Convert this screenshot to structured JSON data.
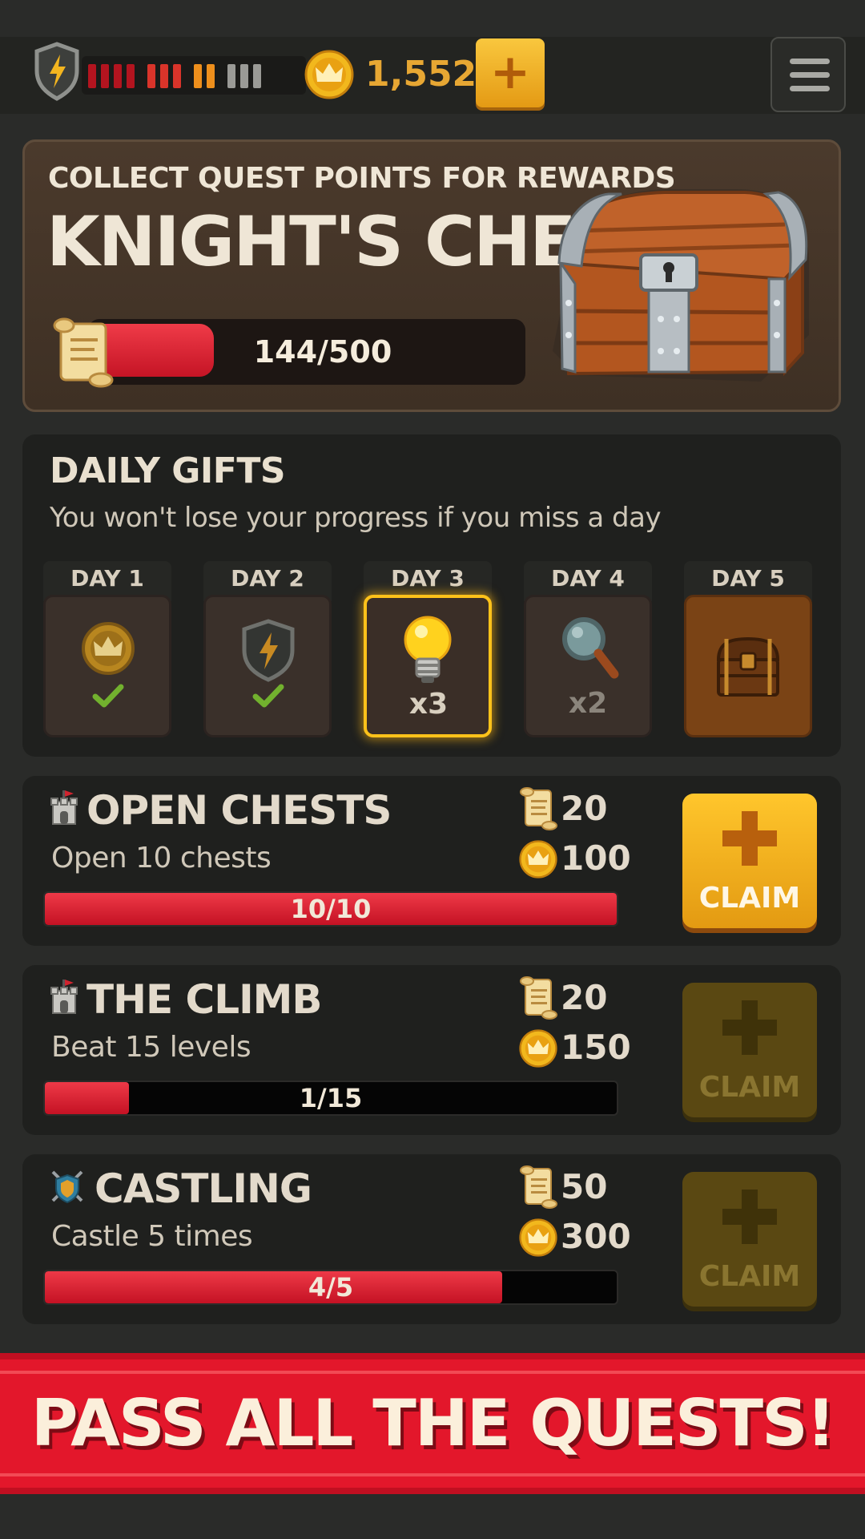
{
  "header": {
    "energy_segments": 13,
    "energy_colors": [
      "#b3141f",
      "#d9342a",
      "#ee8f1c",
      "#9a9a96"
    ],
    "coins": "1,552",
    "add_coins_label": "+",
    "menu_icon": "hamburger-menu-icon"
  },
  "knights_chest": {
    "subtitle": "COLLECT QUEST POINTS FOR REWARDS",
    "title": "KNIGHT'S CHEST",
    "progress_label": "144/500",
    "progress": 0.288,
    "icon": "treasure-chest-icon"
  },
  "daily_gifts": {
    "title": "DAILY GIFTS",
    "subtitle": "You won't lose your progress if you miss a day",
    "days": [
      {
        "label": "DAY 1",
        "icon": "crown-coin-icon",
        "qty": "",
        "claimed": true
      },
      {
        "label": "DAY 2",
        "icon": "energy-shield-icon",
        "qty": "",
        "claimed": true
      },
      {
        "label": "DAY 3",
        "icon": "lightbulb-icon",
        "qty": "x3",
        "claimed": false,
        "active": true
      },
      {
        "label": "DAY 4",
        "icon": "magnifier-icon",
        "qty": "x2",
        "claimed": false
      },
      {
        "label": "DAY 5",
        "icon": "chest-icon",
        "qty": "",
        "claimed": false
      }
    ]
  },
  "quests": [
    {
      "title": "OPEN CHESTS",
      "desc": "Open 10 chests",
      "points": "20",
      "coins": "100",
      "progress_label": "10/10",
      "progress": 1.0,
      "claim": "CLAIM",
      "claimable": true,
      "icon": "castle-tower-icon"
    },
    {
      "title": "THE CLIMB",
      "desc": "Beat 15 levels",
      "points": "20",
      "coins": "150",
      "progress_label": "1/15",
      "progress": 0.1467,
      "claim": "CLAIM",
      "claimable": false,
      "icon": "castle-tower-icon"
    },
    {
      "title": "CASTLING",
      "desc": "Castle 5 times",
      "points": "50",
      "coins": "300",
      "progress_label": "4/5",
      "progress": 0.8,
      "claim": "CLAIM",
      "claimable": false,
      "icon": "crossed-swords-shield-icon"
    }
  ],
  "banner": {
    "text": "PASS ALL THE QUESTS!"
  }
}
